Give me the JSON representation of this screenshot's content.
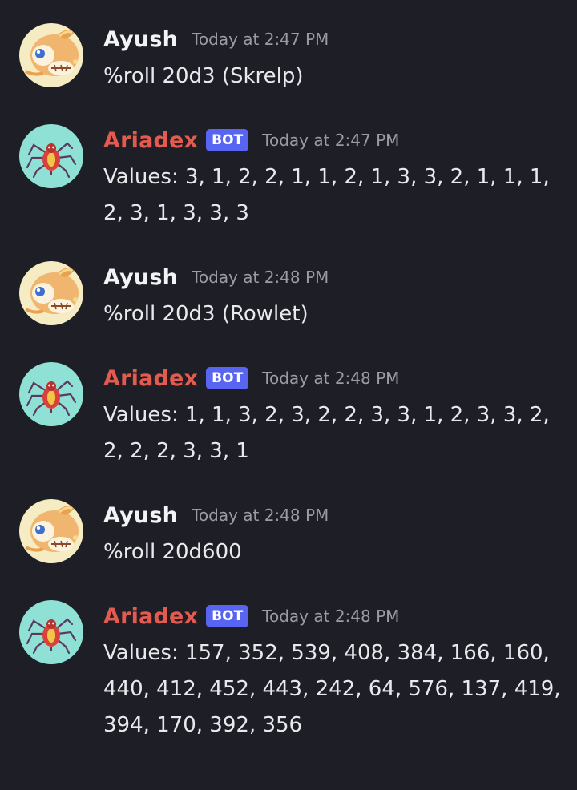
{
  "colors": {
    "background": "#1e1f26",
    "user_name": "#f2f3f5",
    "bot_name": "#e35a4f",
    "bot_tag": "#5865f2",
    "timestamp": "#9a9ca5",
    "message_text": "#e8e9ec"
  },
  "messages": [
    {
      "author": "Ayush",
      "timestamp": "Today at 2:47 PM",
      "text": "%roll 20d3 (Skrelp)",
      "avatar_icon": "pokemon-avatar-icon"
    },
    {
      "author": "Ariadex",
      "bot_tag": "BOT",
      "timestamp": "Today at 2:47 PM",
      "text": "Values: 3, 1, 2, 2, 1, 1, 2, 1, 3, 3, 2, 1, 1, 1, 2, 3, 1, 3, 3, 3",
      "avatar_icon": "spider-pokemon-avatar-icon"
    },
    {
      "author": "Ayush",
      "timestamp": "Today at 2:48 PM",
      "text": "%roll 20d3 (Rowlet)",
      "avatar_icon": "pokemon-avatar-icon"
    },
    {
      "author": "Ariadex",
      "bot_tag": "BOT",
      "timestamp": "Today at 2:48 PM",
      "text": "Values: 1, 1, 3, 2, 3, 2, 2, 3, 3, 1, 2, 3, 3, 2, 2, 2, 2, 3, 3, 1",
      "avatar_icon": "spider-pokemon-avatar-icon"
    },
    {
      "author": "Ayush",
      "timestamp": "Today at 2:48 PM",
      "text": "%roll 20d600",
      "avatar_icon": "pokemon-avatar-icon"
    },
    {
      "author": "Ariadex",
      "bot_tag": "BOT",
      "timestamp": "Today at 2:48 PM",
      "text": "Values: 157, 352, 539, 408, 384, 166, 160, 440, 412, 452, 443, 242, 64, 576, 137, 419, 394, 170, 392, 356",
      "avatar_icon": "spider-pokemon-avatar-icon"
    }
  ]
}
